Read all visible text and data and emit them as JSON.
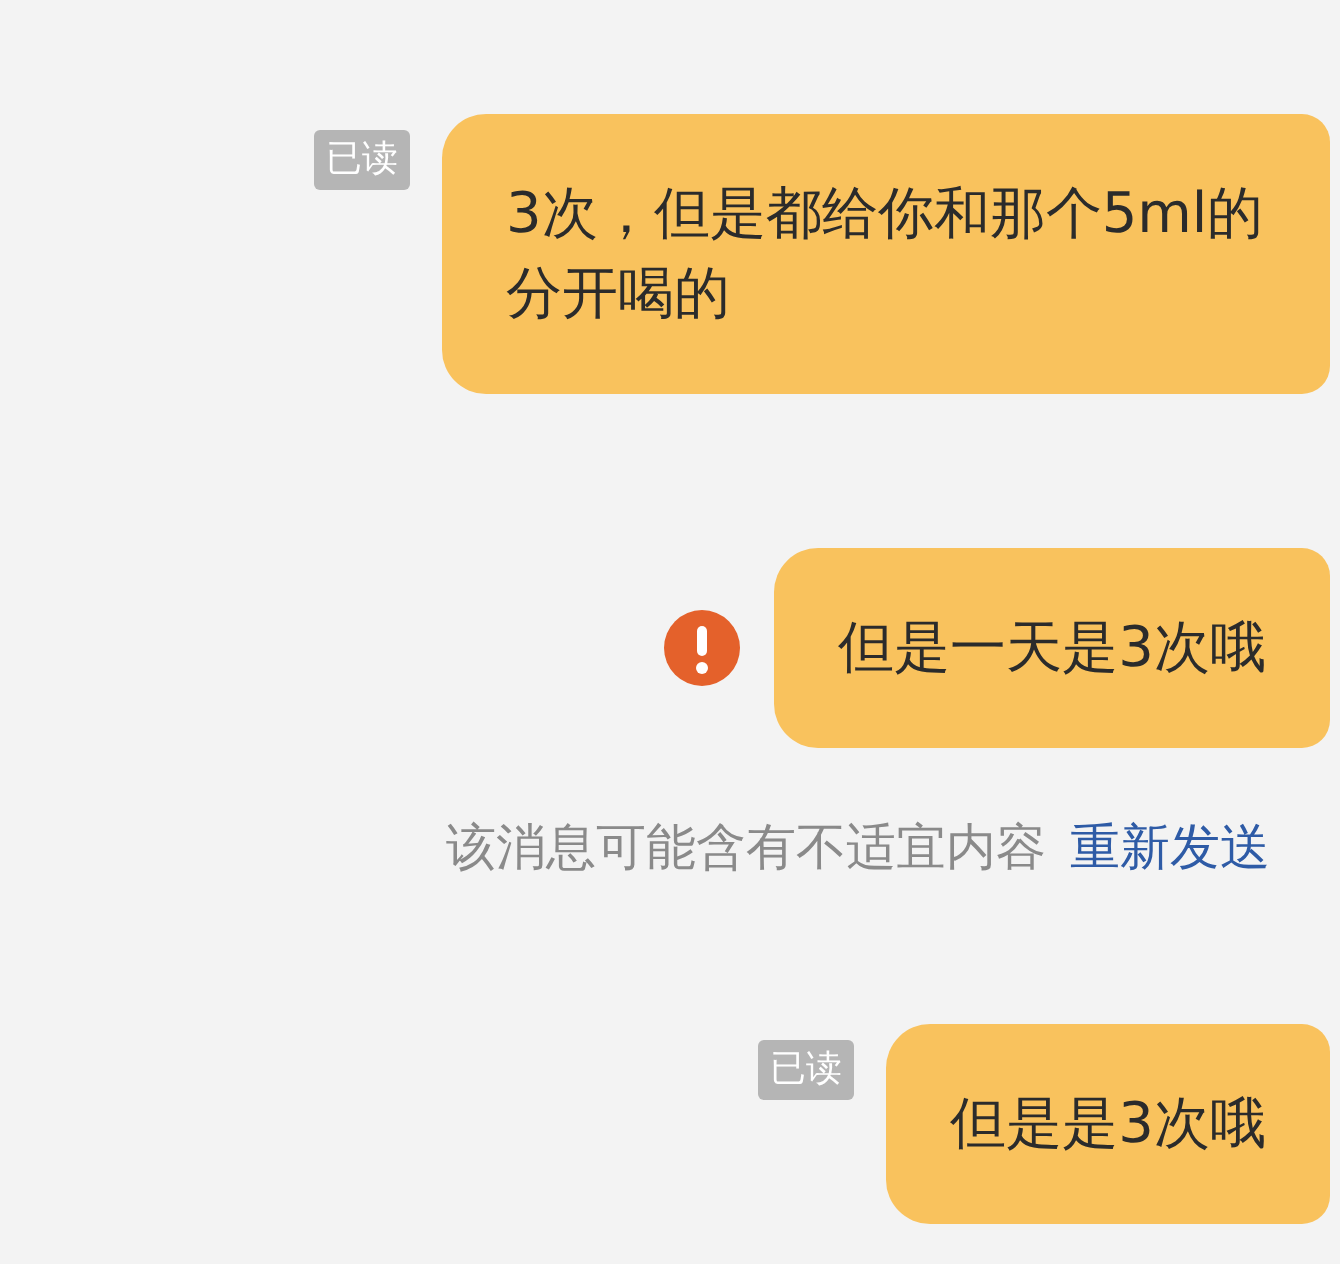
{
  "messages": [
    {
      "kind": "bubble",
      "text": "3次，但是都给你和那个5ml的分开喝的",
      "receipt": "已读",
      "failed": false
    },
    {
      "kind": "bubble",
      "text": "但是一天是3次哦",
      "failed": true
    },
    {
      "kind": "notice",
      "text": "该消息可能含有不适宜内容",
      "action": "重新发送"
    },
    {
      "kind": "bubble",
      "text": "但是是3次哦",
      "receipt": "已读",
      "failed": false
    }
  ]
}
